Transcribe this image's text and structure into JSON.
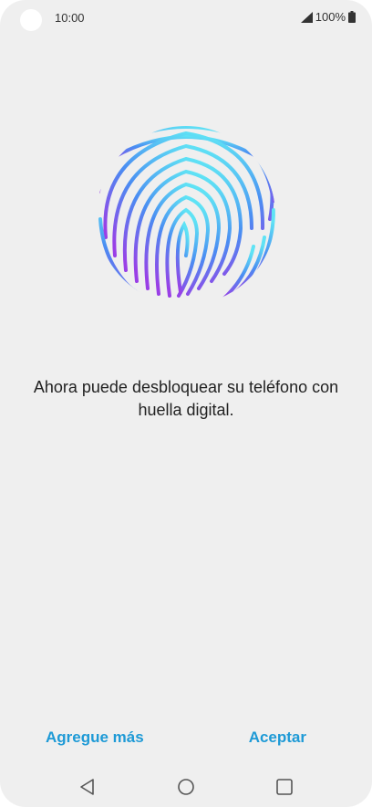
{
  "status_bar": {
    "time": "10:00",
    "battery": "100%",
    "icons": [
      "signal-icon",
      "battery-icon"
    ]
  },
  "illustration": {
    "icon": "fingerprint-icon",
    "gradient_top": "#5fe3f5",
    "gradient_mid": "#4a8df2",
    "gradient_bottom": "#9a3fe6"
  },
  "message": {
    "text": "Ahora puede desbloquear su teléfono con huella digital."
  },
  "actions": {
    "add_more_label": "Agregue más",
    "accept_label": "Aceptar",
    "accent_color": "#1e9ad6"
  },
  "nav_bar": {
    "icons": [
      "back-icon",
      "home-icon",
      "recent-apps-icon"
    ]
  }
}
